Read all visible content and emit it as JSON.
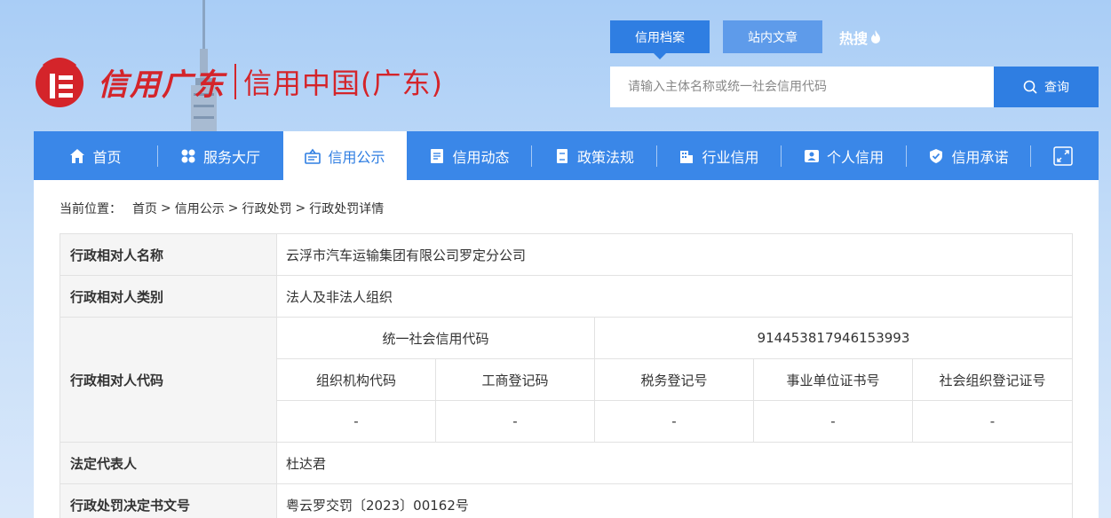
{
  "header": {
    "logo_script": "信用广东",
    "logo_cn": "信用中国(广东)",
    "search_tabs": [
      "信用档案",
      "站内文章"
    ],
    "hot_label": "热搜",
    "search_placeholder": "请输入主体名称或统一社会信用代码",
    "search_button": "查询"
  },
  "nav": {
    "items": [
      {
        "label": "首页",
        "icon": "home-icon"
      },
      {
        "label": "服务大厅",
        "icon": "grid-icon"
      },
      {
        "label": "信用公示",
        "icon": "board-icon"
      },
      {
        "label": "信用动态",
        "icon": "news-icon"
      },
      {
        "label": "政策法规",
        "icon": "book-icon"
      },
      {
        "label": "行业信用",
        "icon": "building-icon"
      },
      {
        "label": "个人信用",
        "icon": "person-card-icon"
      },
      {
        "label": "信用承诺",
        "icon": "shield-check-icon"
      }
    ],
    "active_index": 2,
    "expand_icon": "expand-icon"
  },
  "breadcrumb": {
    "label": "当前位置：",
    "items": [
      "首页",
      "信用公示",
      "行政处罚",
      "行政处罚详情"
    ],
    "separator": ">"
  },
  "detail": {
    "name_label": "行政相对人名称",
    "name_value": "云浮市汽车运输集团有限公司罗定分公司",
    "type_label": "行政相对人类别",
    "type_value": "法人及非法人组织",
    "code_label": "行政相对人代码",
    "uscc_label": "统一社会信用代码",
    "uscc_value": "914453817946153993",
    "sub_headers": [
      "组织机构代码",
      "工商登记码",
      "税务登记号",
      "事业单位证书号",
      "社会组织登记证号"
    ],
    "sub_values": [
      "-",
      "-",
      "-",
      "-",
      "-"
    ],
    "rep_label": "法定代表人",
    "rep_value": "杜达君",
    "decision_label": "行政处罚决定书文号",
    "decision_value": "粤云罗交罚〔2023〕00162号"
  },
  "colors": {
    "brand_red": "#d4242a",
    "nav_blue": "#3a87e8",
    "accent_blue": "#2f7ee2"
  }
}
